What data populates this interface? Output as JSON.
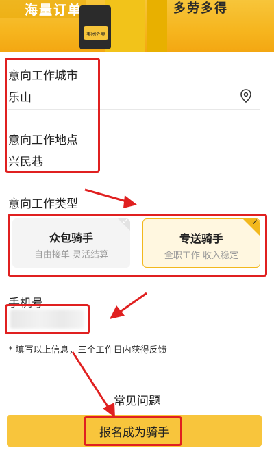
{
  "banner": {
    "left_text": "海量订单",
    "right_text": "多劳多得",
    "badge_text": "美团外卖"
  },
  "form": {
    "city_label": "意向工作城市",
    "city_value": "乐山",
    "location_label": "意向工作地点",
    "location_value": "兴民巷",
    "type_label": "意向工作类型",
    "types": [
      {
        "title": "众包骑手",
        "subtitle": "自由接单 灵活结算",
        "selected": false
      },
      {
        "title": "专送骑手",
        "subtitle": "全职工作 收入稳定",
        "selected": true
      }
    ],
    "phone_label": "手机号",
    "hint": "* 填写以上信息，三个工作日内获得反馈"
  },
  "faq": {
    "title": "常见问题"
  },
  "submit": {
    "label": "报名成为骑手"
  },
  "colors": {
    "accent": "#f8c53c",
    "annotation": "#e02020"
  }
}
